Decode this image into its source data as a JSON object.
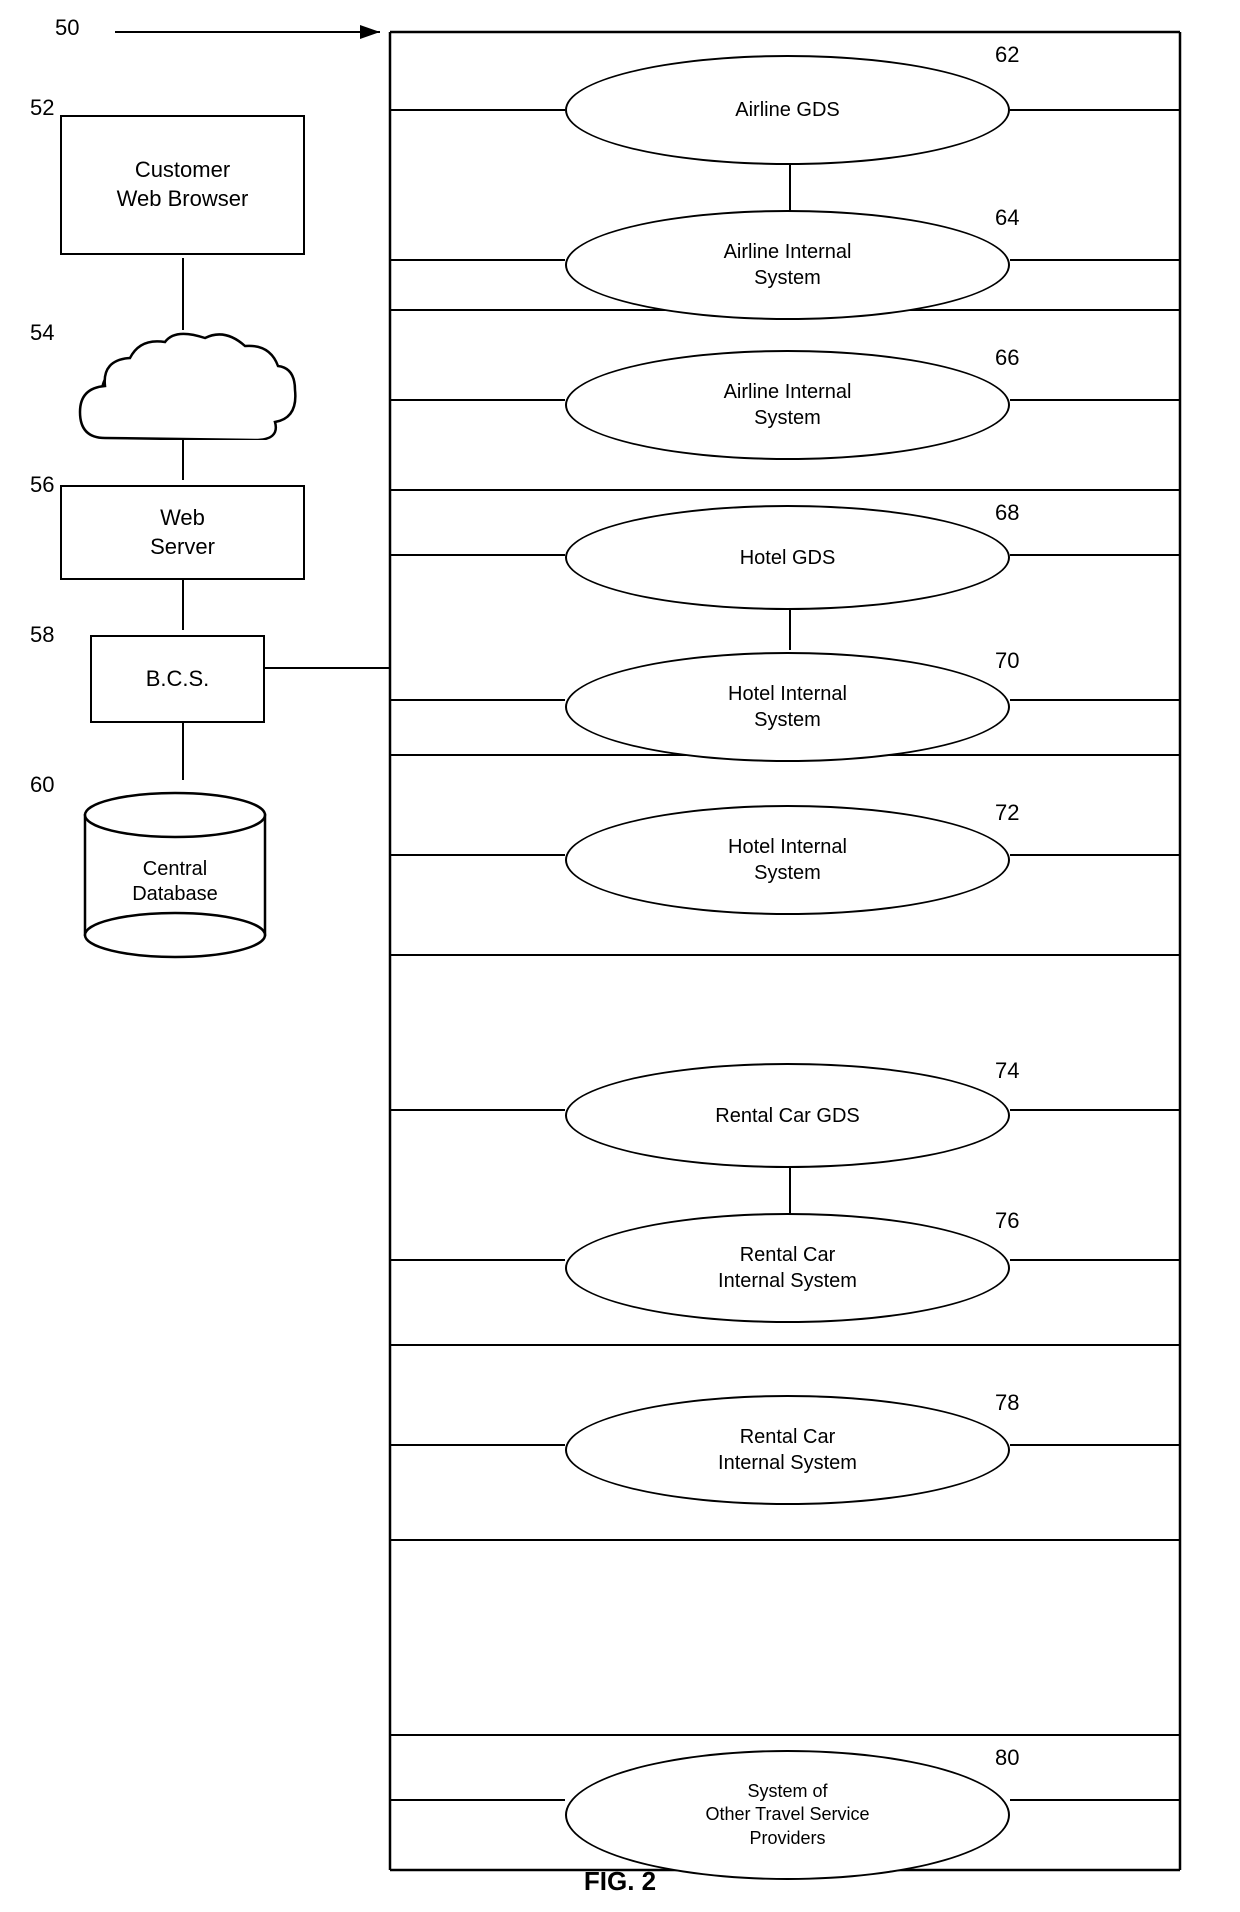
{
  "diagram": {
    "title": "FIG. 2",
    "main_ref": "50",
    "nodes": {
      "customer_web_browser": {
        "label": "Customer\nWeb Browser",
        "ref": "52"
      },
      "internet": {
        "label": "",
        "ref": "54"
      },
      "web_server": {
        "label": "Web\nServer",
        "ref": "56"
      },
      "bcs": {
        "label": "B.C.S.",
        "ref": "58"
      },
      "central_database": {
        "label": "Central\nDatabase",
        "ref": "60"
      },
      "airline_gds": {
        "label": "Airline GDS",
        "ref": "62"
      },
      "airline_internal_1": {
        "label": "Airline Internal\nSystem",
        "ref": "64"
      },
      "airline_internal_2": {
        "label": "Airline Internal\nSystem",
        "ref": "66"
      },
      "hotel_gds": {
        "label": "Hotel GDS",
        "ref": "68"
      },
      "hotel_internal_1": {
        "label": "Hotel Internal\nSystem",
        "ref": "70"
      },
      "hotel_internal_2": {
        "label": "Hotel Internal\nSystem",
        "ref": "72"
      },
      "rental_car_gds": {
        "label": "Rental Car GDS",
        "ref": "74"
      },
      "rental_car_internal_1": {
        "label": "Rental Car\nInternal System",
        "ref": "76"
      },
      "rental_car_internal_2": {
        "label": "Rental Car\nInternal System",
        "ref": "78"
      },
      "other_travel": {
        "label": "System of\nOther Travel Service\nProviders",
        "ref": "80"
      }
    }
  }
}
